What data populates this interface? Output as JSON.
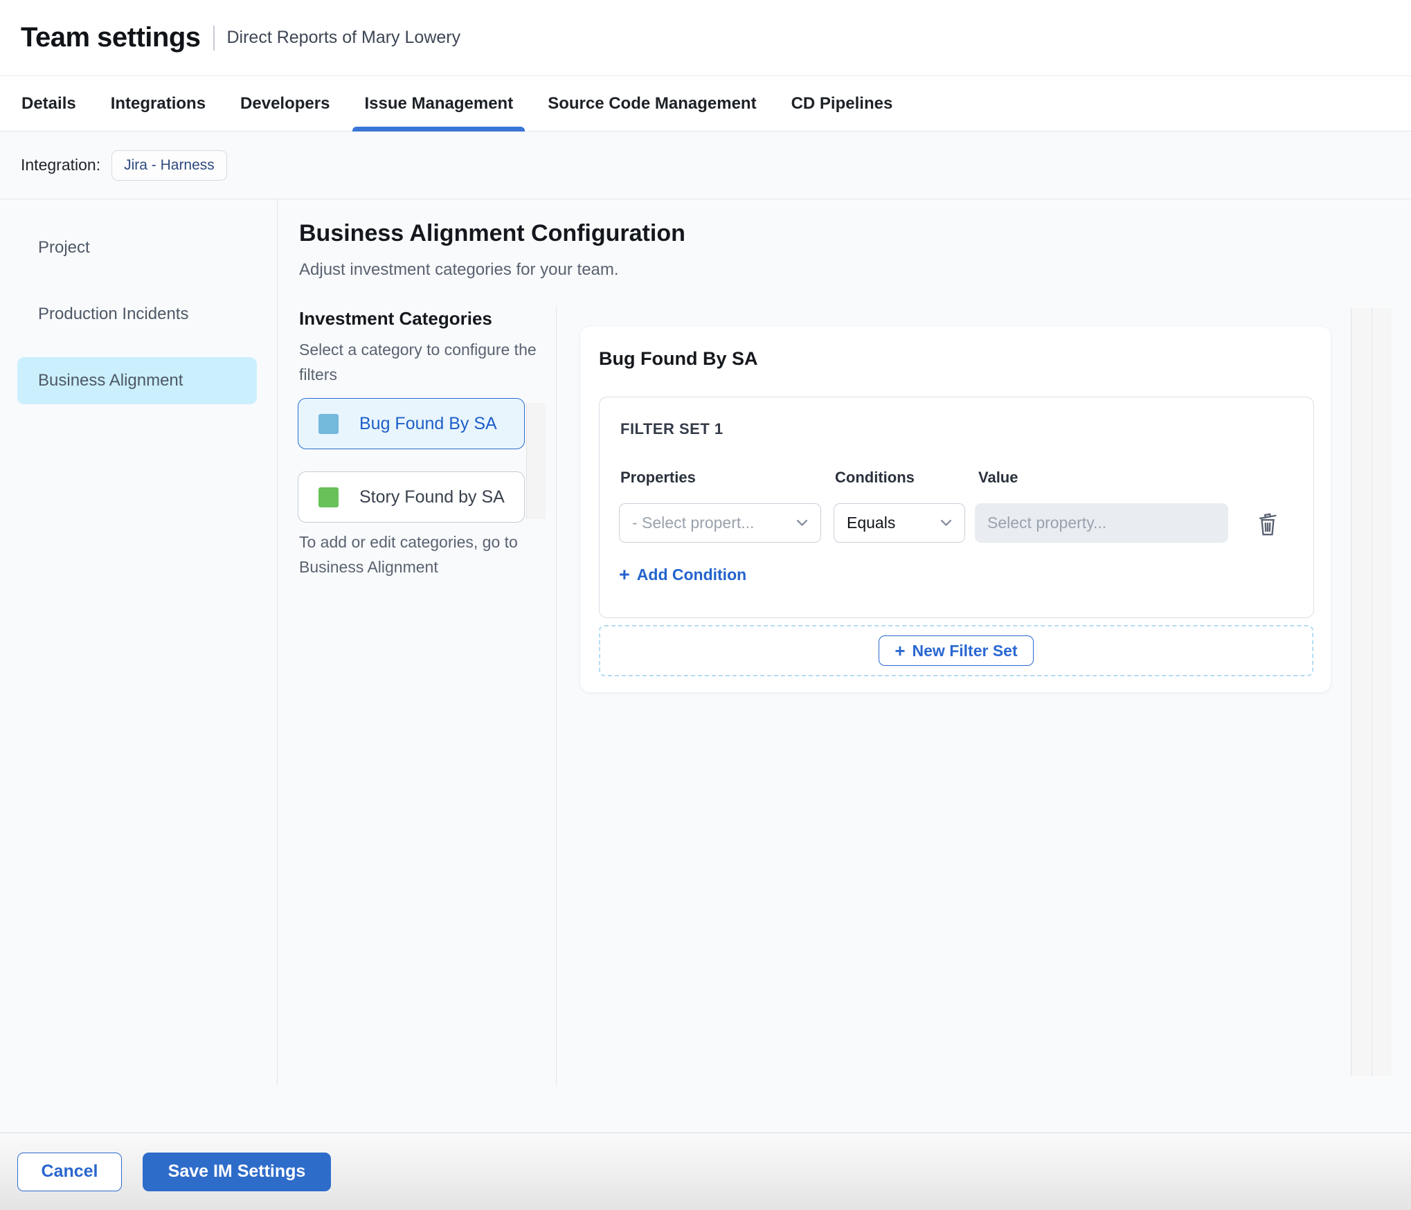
{
  "header": {
    "title": "Team settings",
    "subtitle": "Direct Reports of Mary Lowery"
  },
  "tabs": [
    {
      "label": "Details",
      "active": false
    },
    {
      "label": "Integrations",
      "active": false
    },
    {
      "label": "Developers",
      "active": false
    },
    {
      "label": "Issue Management",
      "active": true
    },
    {
      "label": "Source Code Management",
      "active": false
    },
    {
      "label": "CD Pipelines",
      "active": false
    }
  ],
  "integration": {
    "label": "Integration:",
    "badge": "Jira - Harness"
  },
  "sidebar": {
    "items": [
      {
        "label": "Project",
        "active": false
      },
      {
        "label": "Production Incidents",
        "active": false
      },
      {
        "label": "Business Alignment",
        "active": true
      }
    ]
  },
  "main": {
    "title": "Business Alignment Configuration",
    "subtitle": "Adjust investment categories for your team.",
    "categories_panel": {
      "title": "Investment Categories",
      "helper": "Select a category to configure the filters",
      "items": [
        {
          "label": "Bug Found By SA",
          "swatch_color": "#72b9dc",
          "selected": true
        },
        {
          "label": "Story Found by SA",
          "swatch_color": "#68c159",
          "selected": false
        }
      ],
      "footnote": "To add or edit categories, go to Business Alignment"
    },
    "config_card": {
      "title": "Bug Found By SA",
      "filter_set": {
        "title": "FILTER SET 1",
        "columns": [
          "Properties",
          "Conditions",
          "Value"
        ],
        "rows": [
          {
            "property_placeholder": "- Select propert...",
            "condition_value": "Equals",
            "value_placeholder": "Select property..."
          }
        ],
        "add_condition_label": "Add Condition",
        "add_icon": "+"
      },
      "new_filter_set_label": "New Filter Set",
      "new_filter_set_icon": "+"
    }
  },
  "footer": {
    "cancel_label": "Cancel",
    "save_label": "Save IM Settings"
  },
  "colors": {
    "accent_blue": "#2a68d2",
    "tab_underline": "#3a76d6",
    "sidebar_selected_bg": "#cbeffc",
    "category_selected_bg": "#e9f5fd",
    "category_selected_border": "#2b6cd0",
    "bug_swatch": "#72b9dc",
    "story_swatch": "#68c159",
    "dashed_zone_border": "#b5dcf4",
    "save_button_bg": "#2e6cca",
    "content_bg": "#f8fafc"
  }
}
